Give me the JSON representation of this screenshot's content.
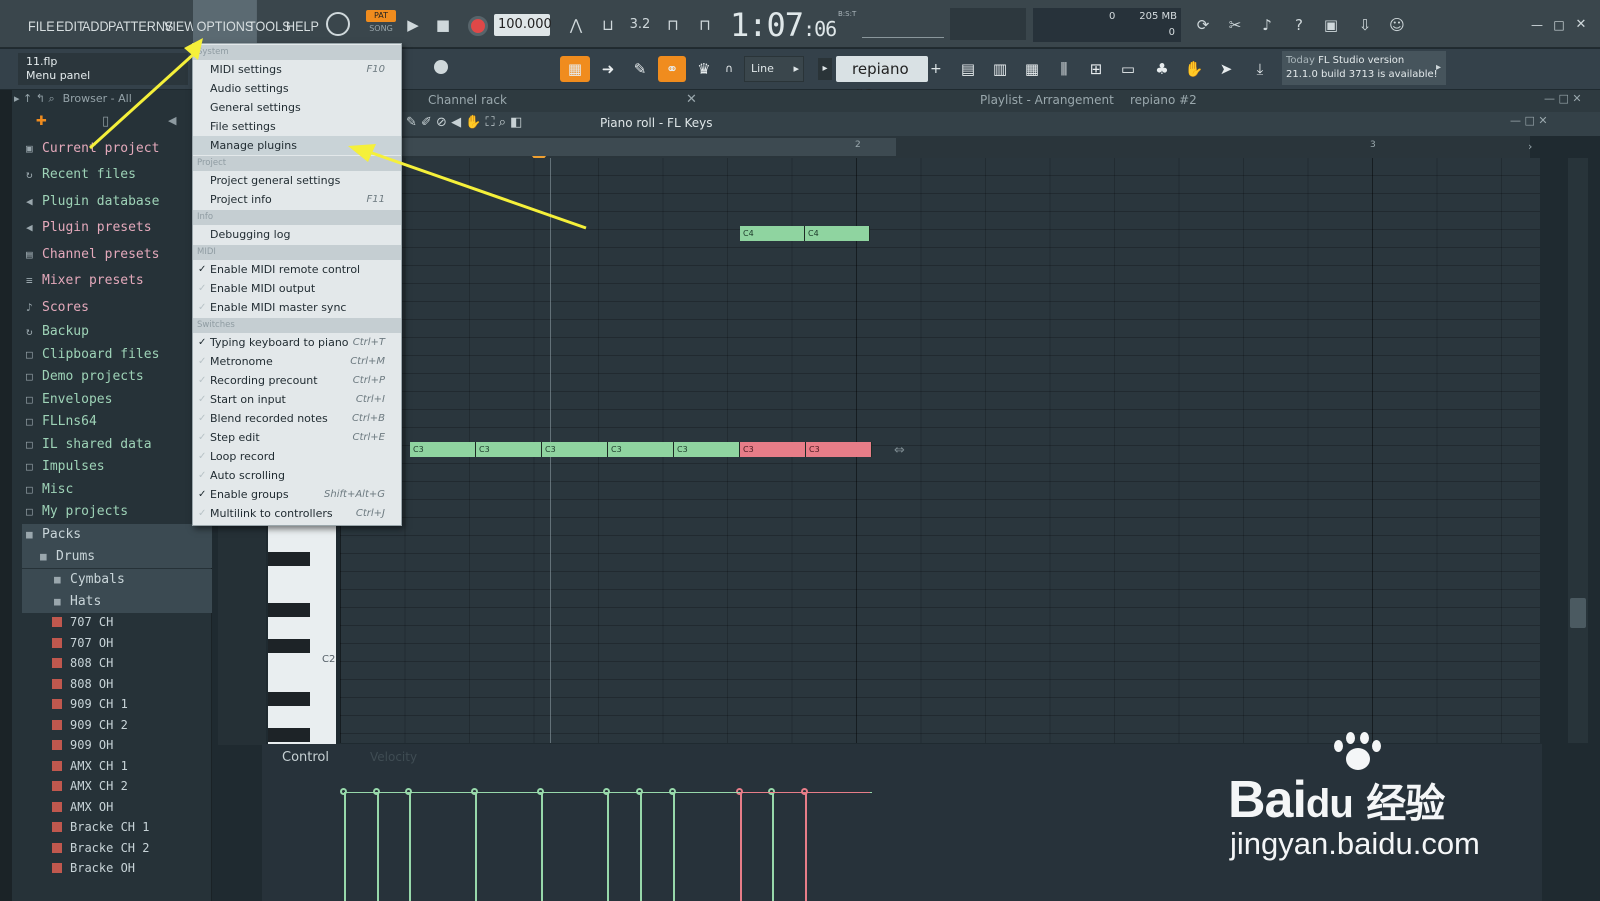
{
  "menu": {
    "items": [
      "FILE",
      "EDIT",
      "ADD",
      "PATTERNS",
      "VIEW",
      "OPTIONS",
      "TOOLS",
      "HELP"
    ]
  },
  "transport": {
    "pat_label": "PAT",
    "song_label": "SONG",
    "tempo": "100.000",
    "time_main": "1:07",
    "time_sub": ":06",
    "time_unit": "B:S:T"
  },
  "monitor": {
    "cpu_value": "0",
    "memory": "205 MB",
    "poly": "0"
  },
  "hint_panel": {
    "file": "11.flp",
    "label": "Menu panel"
  },
  "toolbar2": {
    "snap": "Line",
    "pattern": "repiano #2",
    "news_date": "Today",
    "news_line1": "FL Studio version",
    "news_line2": "21.1.0 build 3713 is available!"
  },
  "browser": {
    "header": "Browser - All",
    "items": [
      {
        "label": "Current project",
        "icon": "▣",
        "kind": "pink"
      },
      {
        "label": "Recent files",
        "icon": "↻",
        "kind": "green"
      },
      {
        "label": "Plugin database",
        "icon": "◀",
        "kind": "green"
      },
      {
        "label": "Plugin presets",
        "icon": "◀",
        "kind": "pink"
      },
      {
        "label": "Channel presets",
        "icon": "▤",
        "kind": "pink"
      },
      {
        "label": "Mixer presets",
        "icon": "≡",
        "kind": "pink"
      },
      {
        "label": "Scores",
        "icon": "♪",
        "kind": "pink"
      },
      {
        "label": "Backup",
        "icon": "↻",
        "kind": "green"
      },
      {
        "label": "Clipboard files",
        "icon": "□",
        "kind": "green"
      },
      {
        "label": "Demo projects",
        "icon": "□",
        "kind": "green"
      },
      {
        "label": "Envelopes",
        "icon": "□",
        "kind": "green"
      },
      {
        "label": "FLLns64",
        "icon": "□",
        "kind": "green"
      },
      {
        "label": "IL shared data",
        "icon": "□",
        "kind": "green"
      },
      {
        "label": "Impulses",
        "icon": "□",
        "kind": "green"
      },
      {
        "label": "Misc",
        "icon": "□",
        "kind": "green"
      },
      {
        "label": "My projects",
        "icon": "□",
        "kind": "green"
      },
      {
        "label": "Packs",
        "icon": "■",
        "kind": "sub"
      },
      {
        "label": "Drums",
        "icon": "■",
        "kind": "sub"
      },
      {
        "label": "Cymbals",
        "icon": "■",
        "kind": "sub"
      },
      {
        "label": "Hats",
        "icon": "■",
        "kind": "sub"
      }
    ],
    "files": [
      "707 CH",
      "707 OH",
      "808 CH",
      "808 OH",
      "909 CH 1",
      "909 CH 2",
      "909 OH",
      "AMX CH 1",
      "AMX CH 2",
      "AMX OH",
      "Bracke CH 1",
      "Bracke CH 2",
      "Bracke OH"
    ]
  },
  "windows": {
    "channel_rack": "Channel rack",
    "piano_roll": "Piano roll - FL Keys",
    "playlist": "Playlist - Arrangement",
    "playlist_pattern": "repiano #2"
  },
  "piano_roll": {
    "bar_numbers": [
      "2",
      "3"
    ],
    "key_label": "C2",
    "notes_c4": [
      "C4",
      "C4"
    ],
    "notes_c3": [
      "C3",
      "C3",
      "C3",
      "C3",
      "C3",
      "C3",
      "C3"
    ],
    "control_label": "Control",
    "control_param": "Velocity"
  },
  "dropdown": {
    "sections": [
      "System",
      "Project",
      "Info",
      "MIDI",
      "Switches"
    ],
    "system_items": [
      {
        "label": "MIDI settings",
        "shortcut": "F10"
      },
      {
        "label": "Audio settings",
        "shortcut": ""
      },
      {
        "label": "General settings",
        "shortcut": ""
      },
      {
        "label": "File settings",
        "shortcut": ""
      },
      {
        "label": "Manage plugins",
        "shortcut": ""
      }
    ],
    "project_items": [
      {
        "label": "Project general settings",
        "shortcut": ""
      },
      {
        "label": "Project info",
        "shortcut": "F11"
      }
    ],
    "info_items": [
      {
        "label": "Debugging log",
        "shortcut": ""
      }
    ],
    "midi_items": [
      {
        "label": "Enable MIDI remote control",
        "checked": true
      },
      {
        "label": "Enable MIDI output",
        "checked": false
      },
      {
        "label": "Enable MIDI master sync",
        "checked": false
      }
    ],
    "switch_items": [
      {
        "label": "Typing keyboard to piano",
        "shortcut": "Ctrl+T",
        "checked": true
      },
      {
        "label": "Metronome",
        "shortcut": "Ctrl+M",
        "checked": false
      },
      {
        "label": "Recording precount",
        "shortcut": "Ctrl+P",
        "checked": false
      },
      {
        "label": "Start on input",
        "shortcut": "Ctrl+I",
        "checked": false
      },
      {
        "label": "Blend recorded notes",
        "shortcut": "Ctrl+B",
        "checked": false
      },
      {
        "label": "Step edit",
        "shortcut": "Ctrl+E",
        "checked": false
      },
      {
        "label": "Loop record",
        "shortcut": "",
        "checked": false
      },
      {
        "label": "Auto scrolling",
        "shortcut": "",
        "checked": false
      },
      {
        "label": "Enable groups",
        "shortcut": "Shift+Alt+G",
        "checked": true
      },
      {
        "label": "Multilink to controllers",
        "shortcut": "Ctrl+J",
        "checked": false
      }
    ]
  },
  "watermark": {
    "brand": "Bai",
    "brand2": "du",
    "cn": "经验",
    "url": "jingyan.baidu.com"
  },
  "colors": {
    "accent": "#f08c1e",
    "note_green": "#8fd4a0",
    "note_red": "#e77d88",
    "arrow": "#f5f03a"
  }
}
